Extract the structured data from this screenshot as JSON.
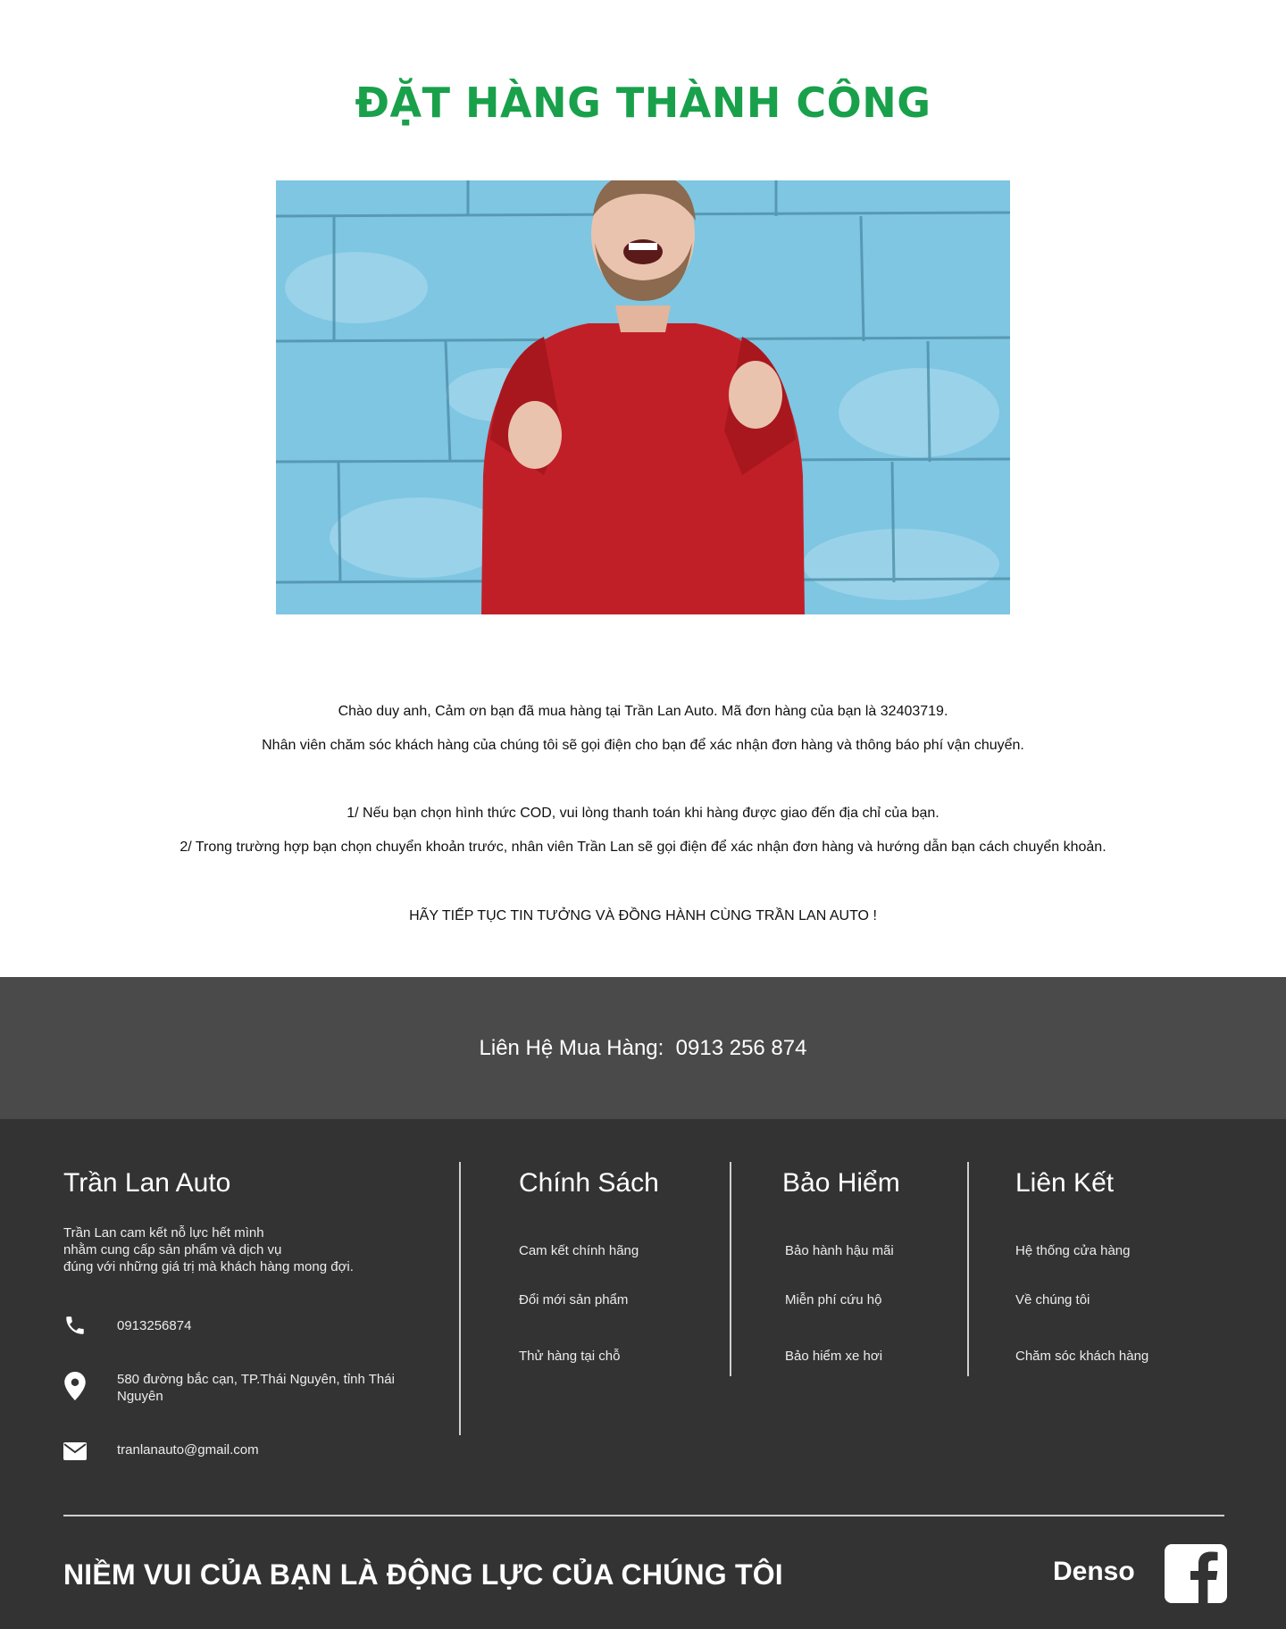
{
  "page": {
    "title": "ĐẶT HÀNG THÀNH CÔNG",
    "title_color": "#19a04b"
  },
  "message": {
    "line1": "Chào duy anh,  Cảm ơn bạn đã mua hàng tại Trần Lan Auto. Mã đơn hàng của bạn là 32403719.",
    "line2": "Nhân viên chăm sóc khách hàng của chúng tôi sẽ gọi điện cho bạn để xác nhận đơn hàng và thông báo phí vận chuyển.",
    "note1": "1/ Nếu bạn chọn hình thức COD, vui lòng thanh toán khi hàng được giao đến địa chỉ của bạn.",
    "note2": "2/ Trong trường hợp bạn chọn chuyển khoản trước, nhân viên Trần Lan sẽ gọi điện để xác nhận đơn hàng và hướng dẫn bạn cách chuyển khoản.",
    "closing": "HÃY TIẾP TỤC TIN TƯỞNG VÀ ĐỒNG HÀNH CÙNG TRẦN LAN AUTO !"
  },
  "contact_band": {
    "label": "Liên Hệ Mua Hàng:",
    "phone": "0913 256 874",
    "background": "#4a4a4a"
  },
  "footer": {
    "background": "#333333",
    "company": {
      "name": "Trần Lan Auto",
      "desc_lines": [
        "Trần Lan cam kết nỗ lực hết mình",
        "nhằm cung cấp sản phẩm và dịch vụ",
        "đúng với những giá trị mà khách hàng mong đợi."
      ],
      "phone": "0913256874",
      "address_lines": [
        "580 đường bắc cạn, TP.Thái Nguyên, tỉnh Thái",
        "Nguyên"
      ],
      "email": "tranlanauto@gmail.com",
      "icons": [
        "phone-icon",
        "location-pin-icon",
        "envelope-icon"
      ]
    },
    "columns": [
      {
        "title": "Chính Sách",
        "links": [
          "Cam kết chính hãng",
          "Đổi mới sản phẩm",
          "Thử hàng tại chỗ"
        ]
      },
      {
        "title": "Bảo Hiểm",
        "links": [
          "Bảo hành hậu mãi",
          "Miễn phí cứu hộ",
          "Bảo hiểm xe hơi"
        ]
      },
      {
        "title": "Liên Kết",
        "links": [
          "Hệ thống cửa hàng",
          "Về chúng tôi",
          "Chăm sóc khách hàng"
        ]
      }
    ],
    "slogan": "NIỀM VUI CỦA BẠN LÀ ĐỘNG LỰC CỦA CHÚNG TÔI",
    "brand": "Denso",
    "social_icon": "facebook-icon"
  }
}
